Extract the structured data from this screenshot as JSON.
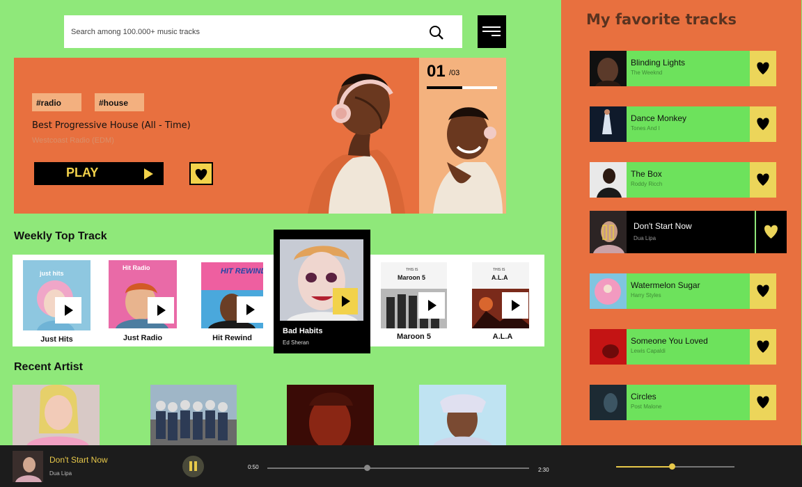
{
  "search": {
    "placeholder": "Search among 100.000+ music tracks"
  },
  "hero": {
    "tags": [
      "#radio",
      "#house"
    ],
    "title": "Best Progressive House (All - Time)",
    "subtitle": "Westcoast Radio (EDM)",
    "play_label": "PLAY",
    "slide_current": "01",
    "slide_total": "/03",
    "slide_progress": 0.5
  },
  "weekly": {
    "title": "Weekly Top Track",
    "tracks": [
      {
        "label": "Just Hits"
      },
      {
        "label": "Just Radio"
      },
      {
        "label": "Hit Rewind"
      },
      {
        "label": "Maroon 5"
      },
      {
        "label": "A.L.A"
      }
    ],
    "featured": {
      "name": "Bad Habits",
      "artist": "Ed Sheran"
    },
    "cover_text": {
      "just_hits": "just hits",
      "hit_radio": "Hit Radio",
      "hit_rewind": "HIT REWIND",
      "this_is": "THIS IS",
      "maroon5": "Maroon 5",
      "ala": "A.L.A"
    }
  },
  "recent": {
    "title": "Recent Artist"
  },
  "favorites": {
    "title": "My favorite tracks",
    "items": [
      {
        "name": "Blinding Lights",
        "artist": "The Weeknd"
      },
      {
        "name": "Dance Monkey",
        "artist": "Tones And I"
      },
      {
        "name": "The Box",
        "artist": "Roddy Ricch"
      },
      {
        "name": "Don't Start Now",
        "artist": "Dua Lipa"
      },
      {
        "name": "Watermelon Sugar",
        "artist": "Harry Styles"
      },
      {
        "name": "Someone You Loved",
        "artist": "Lewis Capaldi"
      },
      {
        "name": "Circles",
        "artist": "Post Malone"
      }
    ]
  },
  "player": {
    "name": "Don't Start Now",
    "artist": "Dua Lipa",
    "elapsed": "0:50",
    "duration": "2:30",
    "progress": 0.38,
    "volume": 0.47
  },
  "colors": {
    "background": "#8fe87a",
    "accent_orange": "#e8703f",
    "accent_yellow": "#f2d24b",
    "black": "#000000"
  }
}
